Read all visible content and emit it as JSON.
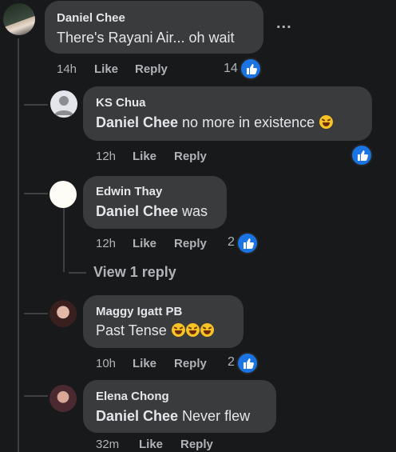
{
  "actions": {
    "like": "Like",
    "reply": "Reply"
  },
  "more_options": "...",
  "main_comment": {
    "author": "Daniel Chee",
    "text": "There's Rayani Air... oh wait",
    "time": "14h",
    "reaction_count": "14"
  },
  "replies": [
    {
      "author": "KS Chua",
      "mention": "Daniel Chee",
      "text": " no more in existence",
      "emojis": [
        "rofl-emoji"
      ],
      "time": "12h",
      "reaction_count": ""
    },
    {
      "author": "Edwin Thay",
      "mention": "Daniel Chee",
      "text": " was",
      "emojis": [],
      "time": "12h",
      "reaction_count": "2"
    },
    {
      "author": "Maggy Igatt PB",
      "mention": "",
      "text": "Past Tense ",
      "emojis": [
        "rofl-emoji",
        "rofl-emoji",
        "rofl-emoji"
      ],
      "time": "10h",
      "reaction_count": "2"
    },
    {
      "author": "Elena Chong",
      "mention": "Daniel Chee",
      "text": " Never flew",
      "emojis": [],
      "time": "32m",
      "reaction_count": ""
    }
  ],
  "view_replies": "View 1 reply",
  "colors": {
    "background": "#18191a",
    "bubble": "#3a3b3c",
    "like_blue": "#1b74e4",
    "muted": "#b0b3b8"
  }
}
